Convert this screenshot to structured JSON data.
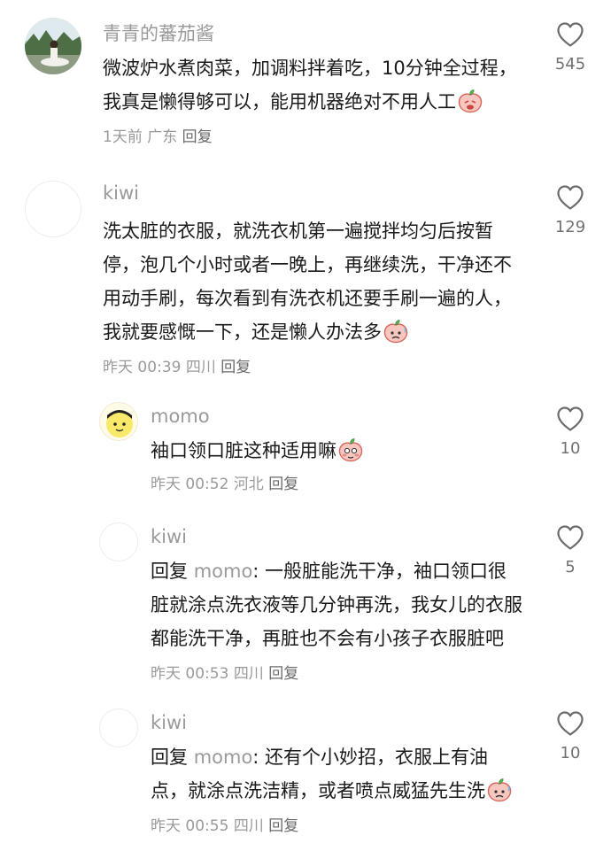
{
  "comments": [
    {
      "username": "青青的蕃茄酱",
      "text": "微波炉水煮肉菜，加调料拌着吃，10分钟全过程，我真是懒得够可以，能用机器绝对不用人工",
      "emoji": "peach-crying-emoji",
      "time": "1天前",
      "location": "广东",
      "reply_label": "回复",
      "likes": "545"
    },
    {
      "username": "kiwi",
      "text": "洗太脏的衣服，就洗衣机第一遍搅拌均匀后按暂停，泡几个小时或者一晚上，再继续洗，干净还不用动手刷，每次看到有洗衣机还要手刷一遍的人，我就要感慨一下，还是懒人办法多",
      "emoji": "peach-sweat-emoji",
      "time": "昨天 00:39",
      "location": "四川",
      "reply_label": "回复",
      "likes": "129"
    },
    {
      "username": "momo",
      "text": "袖口领口脏这种适用嘛",
      "emoji": "peach-shy-emoji",
      "time": "昨天 00:52",
      "location": "河北",
      "reply_label": "回复",
      "likes": "10"
    },
    {
      "username": "kiwi",
      "reply_prefix": "回复",
      "reply_to": "momo",
      "text": ": 一般脏能洗干净，袖口领口很脏就涂点洗衣液等几分钟再洗，我女儿的衣服都能洗干净，再脏也不会有小孩子衣服脏吧",
      "time": "昨天 00:53",
      "location": "四川",
      "reply_label": "回复",
      "likes": "5"
    },
    {
      "username": "kiwi",
      "reply_prefix": "回复",
      "reply_to": "momo",
      "text": ": 还有个小妙招，衣服上有油点，就涂点洗洁精，或者喷点威猛先生洗",
      "emoji": "peach-sweat-emoji",
      "time": "昨天 00:55",
      "location": "四川",
      "reply_label": "回复",
      "likes": "10"
    }
  ]
}
